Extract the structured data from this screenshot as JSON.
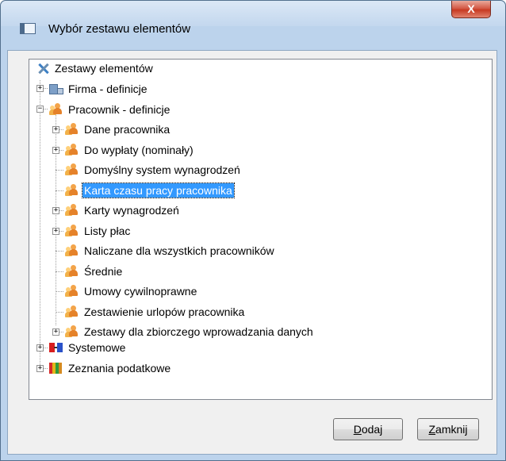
{
  "window": {
    "title": "Wybór zestawu elementów",
    "close_label": "X"
  },
  "tree": {
    "root": "Zestawy elementów",
    "nodes": [
      {
        "label": "Firma - definicje",
        "icon": "building-icon",
        "expander": "+"
      },
      {
        "label": "Pracownik - definicje",
        "icon": "people-icon",
        "expander": "−"
      },
      {
        "label": "Dane pracownika",
        "icon": "people-icon",
        "expander": "+"
      },
      {
        "label": "Do wypłaty (nominały)",
        "icon": "people-icon",
        "expander": "+"
      },
      {
        "label": "Domyślny system wynagrodzeń",
        "icon": "people-icon"
      },
      {
        "label": "Karta czasu pracy pracownika",
        "icon": "people-icon",
        "selected": true
      },
      {
        "label": "Karty wynagrodzeń",
        "icon": "people-icon",
        "expander": "+"
      },
      {
        "label": "Listy płac",
        "icon": "people-icon",
        "expander": "+"
      },
      {
        "label": "Naliczane dla wszystkich pracowników",
        "icon": "people-icon"
      },
      {
        "label": "Średnie",
        "icon": "people-icon"
      },
      {
        "label": "Umowy cywilnoprawne",
        "icon": "people-icon"
      },
      {
        "label": "Zestawienie urlopów pracownika",
        "icon": "people-icon"
      },
      {
        "label": "Zestawy dla zbiorczego wprowadzania danych",
        "icon": "people-icon",
        "expander": "+"
      },
      {
        "label": "Systemowe",
        "icon": "system-icon",
        "expander": "+"
      },
      {
        "label": "Zeznania podatkowe",
        "icon": "books-icon",
        "expander": "+"
      }
    ]
  },
  "buttons": {
    "add_mnemonic": "D",
    "add_rest": "odaj",
    "close_mnemonic": "Z",
    "close_rest": "amknij"
  },
  "colors": {
    "selection": "#3399ff",
    "titlebar": "#c3d7ee",
    "close_button": "#c73a22"
  }
}
